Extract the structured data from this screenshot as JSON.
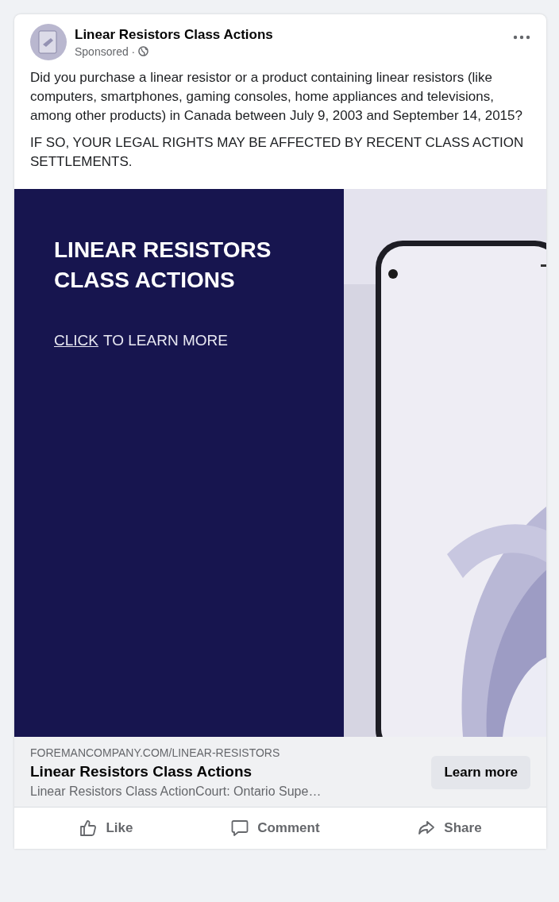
{
  "post": {
    "page_name": "Linear Resistors Class Actions",
    "meta": "Sponsored ·",
    "body": [
      "Did you purchase a linear resistor or a product containing linear resistors (like computers, smartphones, gaming consoles, home appliances and televisions, among other products) in Canada between July 9, 2003 and September 14, 2015?",
      "IF SO, YOUR LEGAL RIGHTS MAY BE AFFECTED BY RECENT CLASS ACTION SETTLEMENTS."
    ]
  },
  "creative": {
    "headline": "LINEAR RESISTORS CLASS ACTIONS",
    "cta_link": "CLICK",
    "cta_rest": "TO LEARN MORE"
  },
  "link_preview": {
    "domain": "FOREMANCOMPANY.COM/LINEAR-RESISTORS",
    "title": "Linear Resistors Class Actions",
    "description": "Linear Resistors Class ActionCourt: Ontario Supe…",
    "button": "Learn more"
  },
  "actions": [
    {
      "kind": "like",
      "label": "Like"
    },
    {
      "kind": "comment",
      "label": "Comment"
    },
    {
      "kind": "share",
      "label": "Share"
    }
  ]
}
